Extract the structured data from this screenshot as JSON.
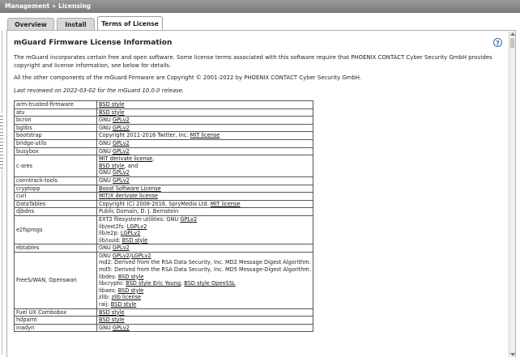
{
  "breadcrumb": {
    "section": "Management",
    "separator": "»",
    "page": "Licensing"
  },
  "tabs": [
    {
      "label": "Overview"
    },
    {
      "label": "Install"
    },
    {
      "label": "Terms of License"
    }
  ],
  "panel": {
    "title": "mGuard Firmware License Information",
    "help_icon": "question-circle-icon",
    "intro": "The mGuard incorporates certain free and open software. Some license terms associated with this software require that PHOENIX CONTACT Cyber Security GmbH provides copyright and license information, see below for details.",
    "copyright": "All the other components of the mGuard Firmware are Copyright © 2001-2022 by PHOENIX CONTACT Cyber Security GmbH.",
    "reviewed": "Last reviewed on 2022-03-02 for the mGuard 10.0.0 release."
  },
  "licenses": [
    {
      "name": "arm-trusted-firmware",
      "lines": [
        [
          {
            "t": "BSD style",
            "link": true
          }
        ]
      ]
    },
    {
      "name": "atv",
      "lines": [
        [
          {
            "t": "BSD style",
            "link": true
          }
        ]
      ]
    },
    {
      "name": "bcron",
      "lines": [
        [
          {
            "t": "GNU "
          },
          {
            "t": "GPLv2",
            "link": true
          }
        ]
      ]
    },
    {
      "name": "bglibs",
      "lines": [
        [
          {
            "t": "GNU "
          },
          {
            "t": "GPLv2",
            "link": true
          }
        ]
      ]
    },
    {
      "name": "bootstrap",
      "lines": [
        [
          {
            "t": "Copyright 2011-2016 Twitter, Inc. "
          },
          {
            "t": "MIT license",
            "link": true
          }
        ]
      ]
    },
    {
      "name": "bridge-utils",
      "lines": [
        [
          {
            "t": "GNU "
          },
          {
            "t": "GPLv2",
            "link": true
          }
        ]
      ]
    },
    {
      "name": "busybox",
      "lines": [
        [
          {
            "t": "GNU "
          },
          {
            "t": "GPLv2",
            "link": true
          }
        ]
      ]
    },
    {
      "name": "c-ares",
      "lines": [
        [
          {
            "t": "MIT derivate license",
            "link": true
          },
          {
            "t": ","
          }
        ],
        [
          {
            "t": "BSD style",
            "link": true
          },
          {
            "t": ", and"
          }
        ],
        [
          {
            "t": "GNU "
          },
          {
            "t": "GPLv2",
            "link": true
          }
        ]
      ]
    },
    {
      "name": "conntrack-tools",
      "lines": [
        [
          {
            "t": "GNU "
          },
          {
            "t": "GPLv2",
            "link": true
          }
        ]
      ]
    },
    {
      "name": "cryptopp",
      "lines": [
        [
          {
            "t": "Boost Software License",
            "link": true
          }
        ]
      ]
    },
    {
      "name": "curl",
      "lines": [
        [
          {
            "t": "MIT/X derivate license",
            "link": true
          }
        ]
      ]
    },
    {
      "name": "DataTables",
      "lines": [
        [
          {
            "t": "Copyright (C) 2008-2016, SpryMedia Ltd. "
          },
          {
            "t": "MIT license",
            "link": true
          }
        ]
      ]
    },
    {
      "name": "djbdns",
      "lines": [
        [
          {
            "t": "Public Domain, D. J. Bernstein"
          }
        ]
      ]
    },
    {
      "name": "e2fsprogs",
      "lines": [
        [
          {
            "t": "EXT2 filesystem utilities: GNU "
          },
          {
            "t": "GPLv2",
            "link": true
          }
        ],
        [
          {
            "t": "lib/ext2fs: "
          },
          {
            "t": "LGPLv2",
            "link": true
          }
        ],
        [
          {
            "t": "lib/e2p: "
          },
          {
            "t": "LGPLv2",
            "link": true
          }
        ],
        [
          {
            "t": "lib/uuid: "
          },
          {
            "t": "BSD style",
            "link": true
          }
        ]
      ]
    },
    {
      "name": "ebtables",
      "lines": [
        [
          {
            "t": "GNU "
          },
          {
            "t": "GPLv2",
            "link": true
          }
        ]
      ]
    },
    {
      "name": "FreeS/WAN, Openswan",
      "lines": [
        [
          {
            "t": "GNU "
          },
          {
            "t": "GPLv2",
            "link": true
          },
          {
            "t": "/"
          },
          {
            "t": "LGPLv2",
            "link": true
          }
        ],
        [
          {
            "t": "md2: Derived from the RSA Data Security, Inc. MD2 Message Digest Algorithm."
          }
        ],
        [
          {
            "t": "md5: Derived from the RSA Data Security, Inc. MD5 Message-Digest Algorithm."
          }
        ],
        [
          {
            "t": "libdes: "
          },
          {
            "t": "BSD style",
            "link": true
          }
        ],
        [
          {
            "t": "libcrypto: "
          },
          {
            "t": "BSD style Eric Young",
            "link": true
          },
          {
            "t": ", "
          },
          {
            "t": "BSD style OpenSSL",
            "link": true
          }
        ],
        [
          {
            "t": "libaes: "
          },
          {
            "t": "BSD style",
            "link": true
          }
        ],
        [
          {
            "t": "zlib: "
          },
          {
            "t": "zlib license",
            "link": true
          }
        ],
        [
          {
            "t": "raij: "
          },
          {
            "t": "BSD style",
            "link": true
          }
        ]
      ]
    },
    {
      "name": "Fuel UX Combobox",
      "lines": [
        [
          {
            "t": "BSD style",
            "link": true
          }
        ]
      ]
    },
    {
      "name": "hdparm",
      "lines": [
        [
          {
            "t": "BSD style",
            "link": true
          }
        ]
      ]
    },
    {
      "name": "inadyn",
      "lines": [
        [
          {
            "t": "GNU "
          },
          {
            "t": "GPLv2",
            "link": true
          }
        ]
      ]
    }
  ]
}
